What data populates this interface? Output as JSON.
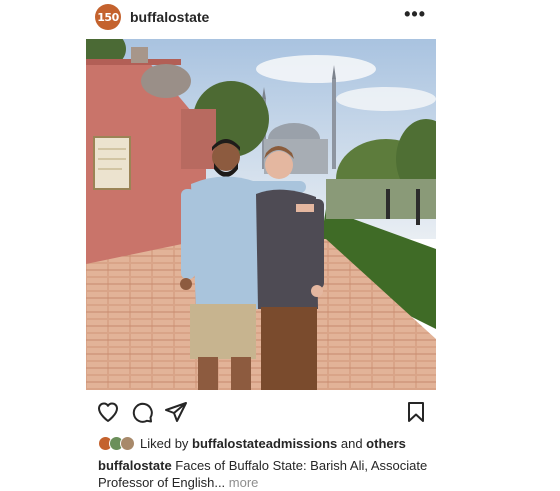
{
  "header": {
    "avatar_text": "150",
    "username": "buffalostate",
    "more_icon": "more-horizontal-icon"
  },
  "photo": {
    "description_icon": "post-photo"
  },
  "actions": {
    "like_icon": "heart-icon",
    "comment_icon": "comment-icon",
    "share_icon": "send-icon",
    "save_icon": "bookmark-icon"
  },
  "likes": {
    "prefix": "Liked by ",
    "user": "buffalostateadmissions",
    "middle": " and ",
    "others": "others"
  },
  "caption": {
    "user": "buffalostate",
    "text": " Faces of Buffalo State: Barish Ali, Associate Professor of English...",
    "more": " more"
  },
  "colors": {
    "avatar_bg": "#c4622d",
    "text": "#262626",
    "muted": "#8e8e8e"
  }
}
